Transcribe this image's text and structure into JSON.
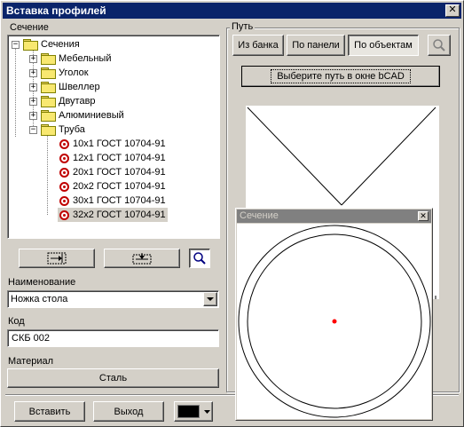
{
  "window": {
    "title": "Вставка профилей",
    "close_glyph": "✕"
  },
  "section": {
    "label": "Сечение",
    "tree": {
      "root": "Сечения",
      "folders": [
        "Мебельный",
        "Уголок",
        "Швеллер",
        "Двутавр",
        "Алюминиевый",
        "Труба"
      ],
      "items": [
        "10x1 ГОСТ 10704-91",
        "12x1 ГОСТ 10704-91",
        "20x1 ГОСТ 10704-91",
        "20x2 ГОСТ 10704-91",
        "30x1 ГОСТ 10704-91",
        "32x2 ГОСТ 10704-91"
      ],
      "selected_item": "32x2 ГОСТ 10704-91"
    }
  },
  "name_field": {
    "label": "Наименование",
    "value": "Ножка стола"
  },
  "code_field": {
    "label": "Код",
    "value": "СКБ 002"
  },
  "material_field": {
    "label": "Материал",
    "value": "Сталь"
  },
  "bottom": {
    "insert_label": "Вставить",
    "exit_label": "Выход",
    "color": "#000000"
  },
  "path": {
    "label": "Путь",
    "tabs": [
      "Из банка",
      "По панели",
      "По объектам"
    ],
    "active_tab": "По объектам",
    "select_button": "Выберите путь в окне bCAD"
  },
  "preview_popup": {
    "title": "Сечение",
    "center_color": "#ff0000"
  },
  "colors": {
    "titlebar": "#0a246a",
    "face": "#d4d0c8",
    "profile_icon": "#c00000"
  }
}
